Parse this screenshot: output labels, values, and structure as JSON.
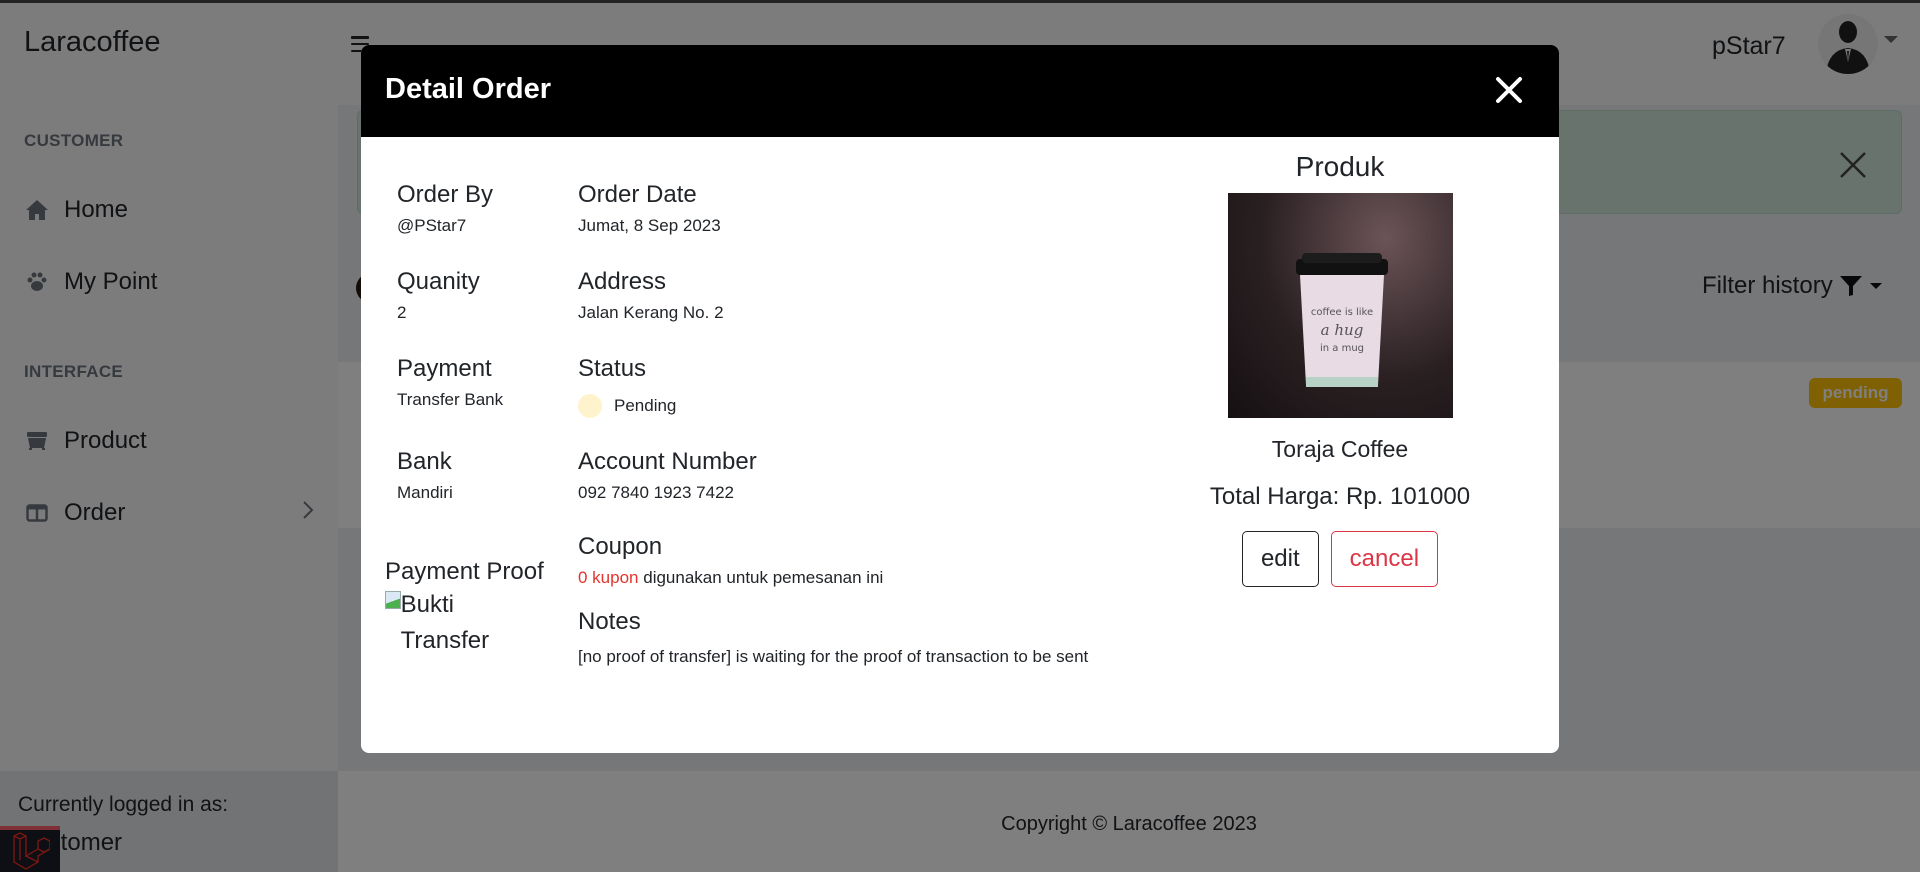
{
  "app": {
    "brand": "Laracoffee",
    "username": "pStar7"
  },
  "sidebar": {
    "sections": [
      {
        "heading": "CUSTOMER",
        "items": [
          {
            "label": "Home",
            "icon": "home-icon"
          },
          {
            "label": "My Point",
            "icon": "paw-icon"
          }
        ]
      },
      {
        "heading": "INTERFACE",
        "items": [
          {
            "label": "Product",
            "icon": "dumpster-icon"
          },
          {
            "label": "Order",
            "icon": "columns-icon",
            "has_submenu": true
          }
        ]
      }
    ],
    "footer": {
      "label": "Currently logged in as:",
      "role": "Customer"
    }
  },
  "page": {
    "filter_label": "Filter history",
    "order_badge": "pending",
    "copyright": "Copyright © Laracoffee 2023"
  },
  "modal": {
    "title": "Detail Order",
    "fields": {
      "order_by": {
        "label": "Order By",
        "value": "@PStar7"
      },
      "order_date": {
        "label": "Order Date",
        "value": "Jumat, 8 Sep 2023"
      },
      "quantity": {
        "label": "Quanity",
        "value": "2"
      },
      "address": {
        "label": "Address",
        "value": "Jalan Kerang No. 2"
      },
      "payment": {
        "label": "Payment",
        "value": "Transfer Bank"
      },
      "status": {
        "label": "Status",
        "value": "Pending",
        "color": "#fff3cd"
      },
      "bank": {
        "label": "Bank",
        "value": "Mandiri"
      },
      "account_number": {
        "label": "Account Number",
        "value": "092 7840 1923 7422"
      },
      "payment_proof": {
        "label": "Payment Proof",
        "alt": "Bukti Transfer"
      },
      "coupon": {
        "label": "Coupon",
        "highlight": "0 kupon",
        "rest": "digunakan untuk pemesanan ini"
      },
      "notes": {
        "label": "Notes",
        "value": "[no proof of transfer] is waiting for the proof of transaction to be sent"
      }
    },
    "product": {
      "heading": "Produk",
      "image_caption_lines": [
        "coffee is like",
        "a hug",
        "in a mug"
      ],
      "name": "Toraja Coffee",
      "total": "Total Harga: Rp. 101000"
    },
    "buttons": {
      "edit": "edit",
      "cancel": "cancel"
    }
  },
  "colors": {
    "accent_red": "#e3342f",
    "cancel_red": "#dc3545",
    "badge_warning": "#ffc107",
    "modal_header": "#000000"
  }
}
